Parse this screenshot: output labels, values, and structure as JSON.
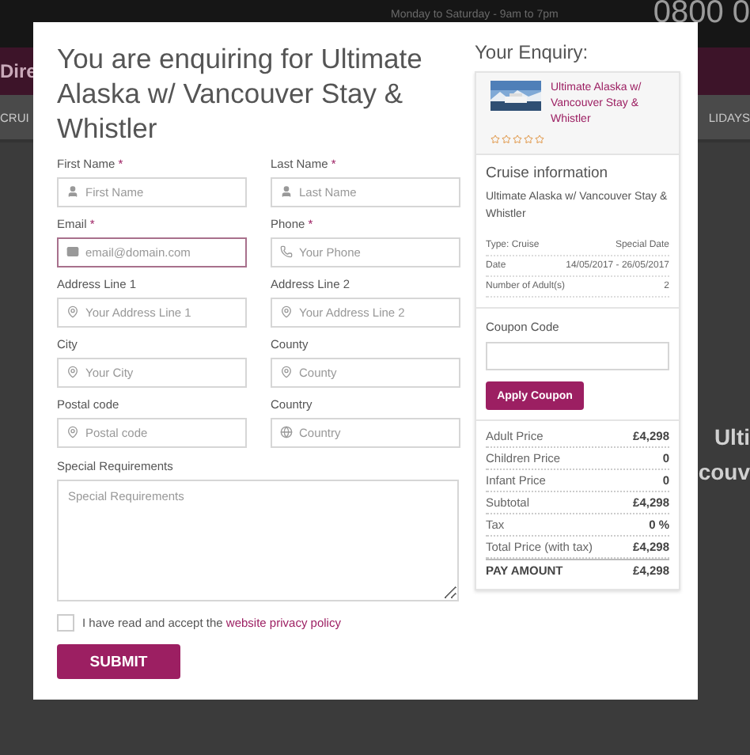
{
  "background": {
    "hours": "Monday to Saturday - 9am to 7pm",
    "phone": "0800 0",
    "brand": "Dire",
    "nav_left": "CRUI",
    "nav_right": "LIDAYS",
    "headline": [
      "Ulti",
      "couv"
    ]
  },
  "modal": {
    "title": "You are enquiring for Ultimate Alaska w/ Vancouver Stay & Whistler",
    "required_mark": "*",
    "fields": [
      {
        "label": "First Name",
        "required": true,
        "placeholder": "First Name",
        "kind": "user",
        "focused": false
      },
      {
        "label": "Last Name",
        "required": true,
        "placeholder": "Last Name",
        "kind": "user",
        "focused": false
      },
      {
        "label": "Email",
        "required": true,
        "placeholder": "email@domain.com",
        "kind": "mail",
        "focused": true
      },
      {
        "label": "Phone",
        "required": true,
        "placeholder": "Your Phone",
        "kind": "phone",
        "focused": false
      },
      {
        "label": "Address Line 1",
        "required": false,
        "placeholder": "Your Address Line 1",
        "kind": "pin",
        "focused": false
      },
      {
        "label": "Address Line 2",
        "required": false,
        "placeholder": "Your Address Line 2",
        "kind": "pin",
        "focused": false
      },
      {
        "label": "City",
        "required": false,
        "placeholder": "Your City",
        "kind": "pin",
        "focused": false
      },
      {
        "label": "County",
        "required": false,
        "placeholder": "County",
        "kind": "pin",
        "focused": false
      },
      {
        "label": "Postal code",
        "required": false,
        "placeholder": "Postal code",
        "kind": "pin",
        "focused": false
      },
      {
        "label": "Country",
        "required": false,
        "placeholder": "Country",
        "kind": "globe",
        "focused": false
      }
    ],
    "special_requirements": {
      "label": "Special Requirements",
      "placeholder": "Special Requirements"
    },
    "consent": {
      "text": "I have read and accept the",
      "link": "website privacy policy",
      "checked": false
    },
    "submit": "SUBMIT"
  },
  "enquiry": {
    "heading": "Your Enquiry:",
    "card": {
      "title": "Ultimate Alaska w/ Vancouver Stay & Whistler",
      "stars": 0
    },
    "cruise_info": {
      "heading": "Cruise information",
      "name": "Ultimate Alaska w/ Vancouver Stay & Whistler",
      "details": [
        {
          "label": "Type: Cruise",
          "value": "Special Date"
        },
        {
          "label": "Date",
          "value": "14/05/2017 - 26/05/2017"
        },
        {
          "label": "Number of Adult(s)",
          "value": "2"
        }
      ]
    },
    "coupon": {
      "label": "Coupon Code",
      "button": "Apply Coupon"
    },
    "prices": [
      {
        "label": "Adult Price",
        "value": "£4,298",
        "kind": "normal"
      },
      {
        "label": "Children Price",
        "value": "0",
        "kind": "normal"
      },
      {
        "label": "Infant Price",
        "value": "0",
        "kind": "normal"
      },
      {
        "label": "Subtotal",
        "value": "£4,298",
        "kind": "normal"
      },
      {
        "label": "Tax",
        "value": "0 %",
        "kind": "normal"
      },
      {
        "label": "Total Price (with tax)",
        "value": "£4,298",
        "kind": "normal"
      },
      {
        "label": "PAY AMOUNT",
        "value": "£4,298",
        "kind": "total"
      }
    ]
  }
}
